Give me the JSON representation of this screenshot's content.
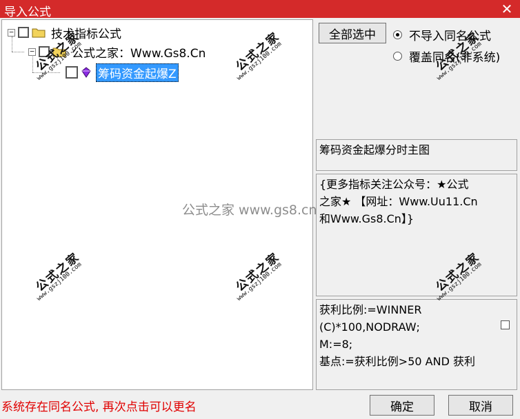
{
  "window": {
    "title": "导入公式",
    "close_glyph": "✕"
  },
  "tree": {
    "root": {
      "label": "技术指标公式",
      "expander": "−",
      "icon": "folder-icon"
    },
    "child": {
      "label": "公式之家：Www.Gs8.Cn",
      "expander": "−",
      "icon": "folder-icon"
    },
    "leaf": {
      "label": "筹码资金起爆Z",
      "icon": "formula-icon",
      "selected": true
    }
  },
  "controls": {
    "select_all_label": "全部选中",
    "radio_options": [
      {
        "label": "不导入同名公式",
        "checked": true
      },
      {
        "label": "覆盖同名(非系统)",
        "checked": false
      }
    ]
  },
  "detail": {
    "formula_name": "筹码资金起爆分时主图",
    "description_lines": [
      "{更多指标关注公众号：★公式",
      "之家★ 【网址：Www.Uu11.Cn",
      "和Www.Gs8.Cn】}"
    ],
    "code_lines": [
      "获利比例:=WINNER",
      "(C)*100,NODRAW;",
      "M:=8;",
      "基点:=获利比例>50 AND 获利"
    ]
  },
  "footer": {
    "status": "系统存在同名公式, 再次点击可以更名",
    "ok_label": "确定",
    "cancel_label": "取消"
  },
  "watermark": {
    "center_text": "公式之家 www.gs8.cn",
    "stamp_main": "公式之家",
    "stamp_sub": "www.gszj100.com"
  },
  "colors": {
    "titlebar": "#d42a2a",
    "selection": "#3399ff",
    "status_text": "#e00000"
  }
}
